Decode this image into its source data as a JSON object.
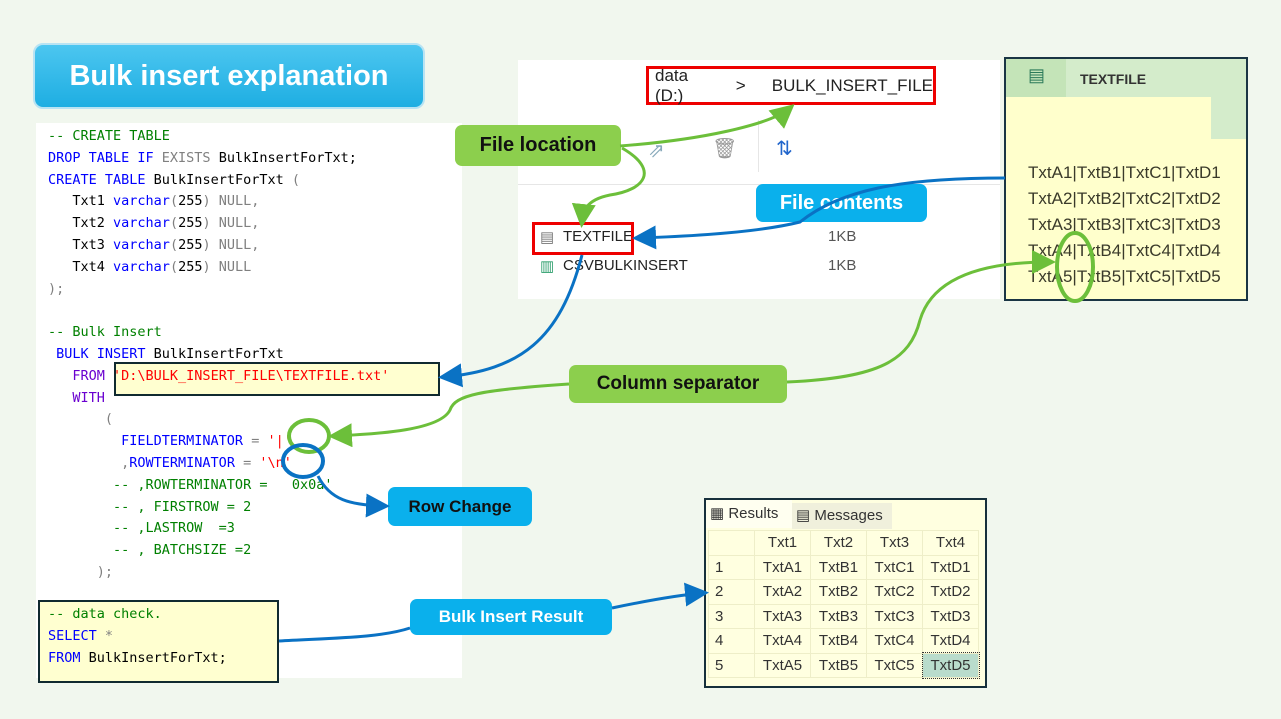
{
  "title": "Bulk insert explanation",
  "code": [
    [
      [
        "-- CREATE TABLE",
        "c"
      ]
    ],
    [
      [
        "DROP TABLE IF ",
        "k"
      ],
      [
        "EXISTS ",
        "g"
      ],
      [
        "BulkInsertForTxt;",
        "t"
      ]
    ],
    [
      [
        "CREATE TABLE ",
        "k"
      ],
      [
        "BulkInsertForTxt ",
        "t"
      ],
      [
        "(",
        "g"
      ]
    ],
    [
      [
        "   Txt1 ",
        "t"
      ],
      [
        "varchar",
        "k"
      ],
      [
        "(",
        "g"
      ],
      [
        "255",
        "t"
      ],
      [
        ") NULL,",
        "g"
      ]
    ],
    [
      [
        "   Txt2 ",
        "t"
      ],
      [
        "varchar",
        "k"
      ],
      [
        "(",
        "g"
      ],
      [
        "255",
        "t"
      ],
      [
        ") NULL,",
        "g"
      ]
    ],
    [
      [
        "   Txt3 ",
        "t"
      ],
      [
        "varchar",
        "k"
      ],
      [
        "(",
        "g"
      ],
      [
        "255",
        "t"
      ],
      [
        ") NULL,",
        "g"
      ]
    ],
    [
      [
        "   Txt4 ",
        "t"
      ],
      [
        "varchar",
        "k"
      ],
      [
        "(",
        "g"
      ],
      [
        "255",
        "t"
      ],
      [
        ") NULL",
        "g"
      ]
    ],
    [
      [
        ");",
        "g"
      ]
    ],
    [
      [
        "",
        "t"
      ]
    ],
    [
      [
        "-- Bulk Insert",
        "c"
      ]
    ],
    [
      [
        " BULK INSERT ",
        "k"
      ],
      [
        "BulkInsertForTxt",
        "t"
      ]
    ],
    [
      [
        "   FROM ",
        "p"
      ],
      [
        "'D:\\BULK_INSERT_FILE\\TEXTFILE.txt'",
        "s"
      ]
    ],
    [
      [
        "   WITH",
        "p"
      ]
    ],
    [
      [
        "       (",
        "g"
      ]
    ],
    [
      [
        "         FIELDTERMINATOR ",
        "k"
      ],
      [
        "= ",
        "g"
      ],
      [
        "'|'",
        "s"
      ]
    ],
    [
      [
        "         ,",
        "g"
      ],
      [
        "ROWTERMINATOR ",
        "k"
      ],
      [
        "= ",
        "g"
      ],
      [
        "'\\n'",
        "s"
      ]
    ],
    [
      [
        "        -- ,ROWTERMINATOR =   0x0a'",
        "c"
      ]
    ],
    [
      [
        "        -- , FIRSTROW = 2",
        "c"
      ]
    ],
    [
      [
        "        -- ,LASTROW  =3",
        "c"
      ]
    ],
    [
      [
        "        -- , BATCHSIZE =2",
        "c"
      ]
    ],
    [
      [
        "      );",
        "g"
      ]
    ]
  ],
  "check": [
    [
      [
        "-- data check.",
        "c"
      ]
    ],
    [
      [
        "SELECT ",
        "k"
      ],
      [
        "*",
        "g"
      ]
    ],
    [
      [
        "FROM ",
        "k"
      ],
      [
        "BulkInsertForTxt;",
        "t"
      ]
    ]
  ],
  "labels": {
    "file_location": "File location",
    "file_contents": "File contents",
    "column_separator": "Column separator",
    "row_change": "Row  Change",
    "bulk_result": "Bulk Insert Result"
  },
  "explorer": {
    "drive": "data (D:)",
    "sep": ">",
    "folder": "BULK_INSERT_FILE",
    "files": [
      {
        "name": "TEXTFILE",
        "size": "1KB",
        "icon": "text-file-icon"
      },
      {
        "name": "CSVBULKINSERT",
        "size": "1KB",
        "icon": "csv-file-icon"
      }
    ]
  },
  "notepad": {
    "tab": "TEXTFILE",
    "lines": [
      "TxtA1|TxtB1|TxtC1|TxtD1",
      "TxtA2|TxtB2|TxtC2|TxtD2",
      "TxtA3|TxtB3|TxtC3|TxtD3",
      "TxtA4|TxtB4|TxtC4|TxtD4",
      "TxtA5|TxtB5|TxtC5|TxtD5"
    ]
  },
  "results": {
    "tabs": [
      "Results",
      "Messages"
    ],
    "columns": [
      "Txt1",
      "Txt2",
      "Txt3",
      "Txt4"
    ],
    "rows": [
      [
        "1",
        "TxtA1",
        "TxtB1",
        "TxtC1",
        "TxtD1"
      ],
      [
        "2",
        "TxtA2",
        "TxtB2",
        "TxtC2",
        "TxtD2"
      ],
      [
        "3",
        "TxtA3",
        "TxtB3",
        "TxtC3",
        "TxtD3"
      ],
      [
        "4",
        "TxtA4",
        "TxtB4",
        "TxtC4",
        "TxtD4"
      ],
      [
        "5",
        "TxtA5",
        "TxtB5",
        "TxtC5",
        "TxtD5"
      ]
    ]
  },
  "colors": {
    "green": "#6cbf3a",
    "blue": "#0a72c4",
    "red": "#e00000",
    "highlight": "#b9dccc"
  }
}
